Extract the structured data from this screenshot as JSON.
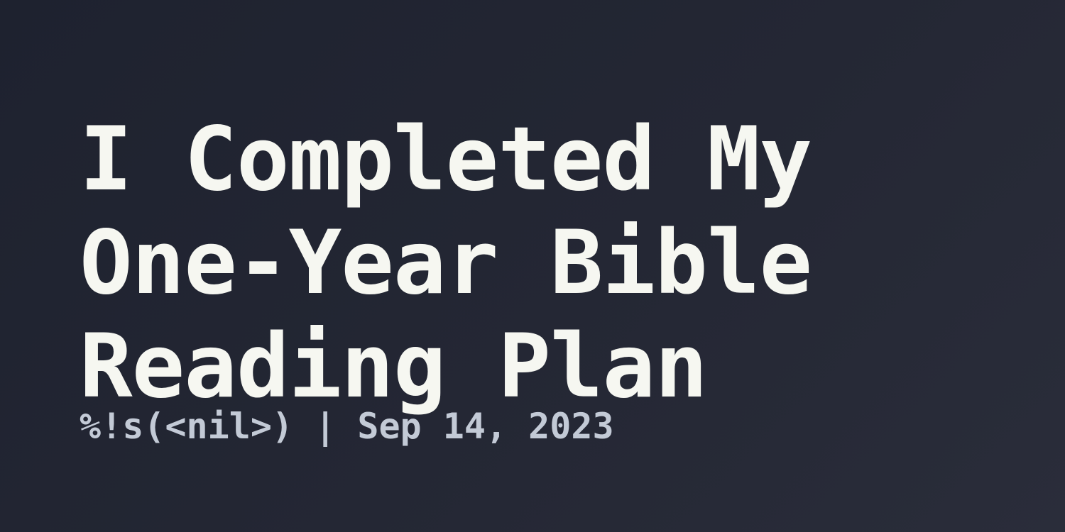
{
  "post": {
    "title_lines": [
      "I Completed My",
      "One-Year Bible",
      "Reading Plan"
    ],
    "author": "%!s(<nil>)",
    "separator": " | ",
    "date": "Sep 14, 2023"
  },
  "colors": {
    "background": "#23262f",
    "title": "#f6f7f1",
    "meta": "#c3cad6"
  }
}
